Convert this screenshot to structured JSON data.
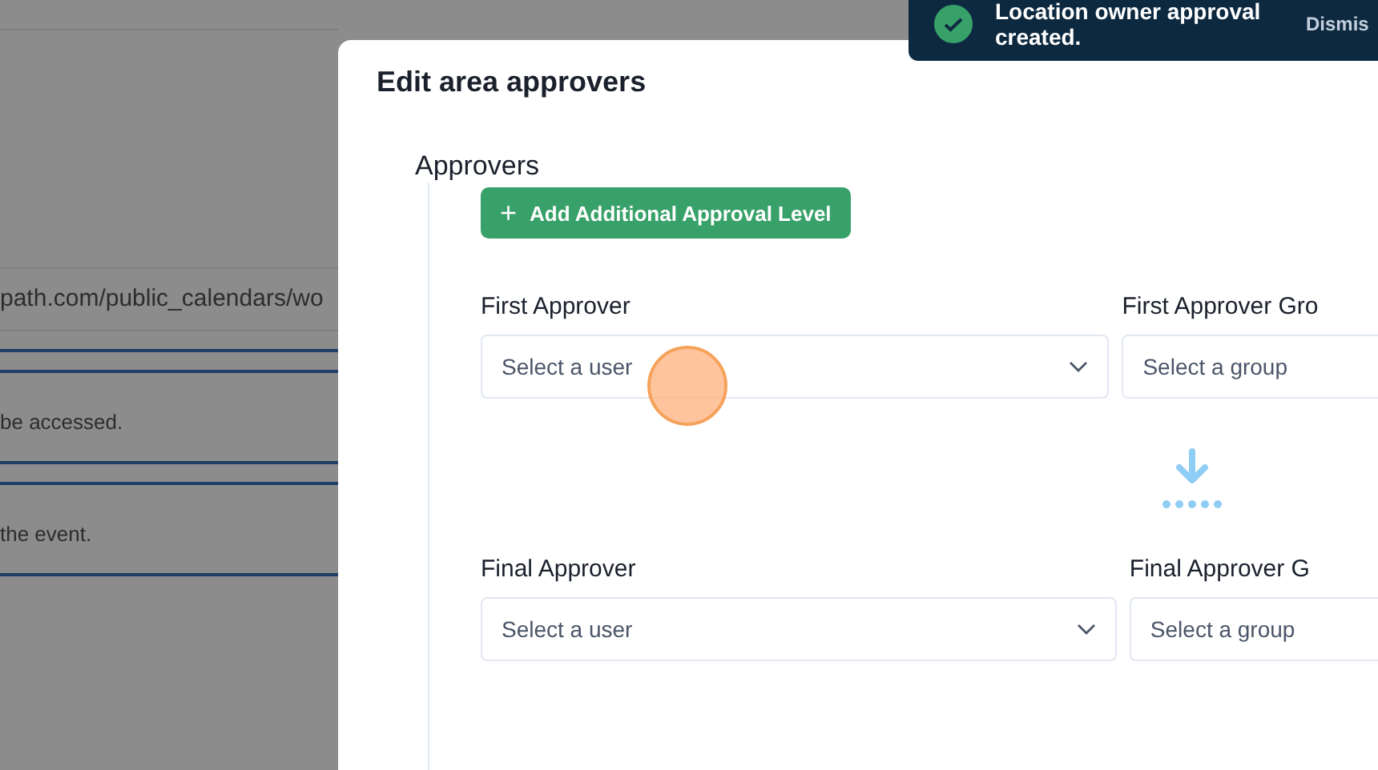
{
  "background_page": {
    "lines": [
      "path.com/public_calendars/wo",
      "be accessed.",
      "the event."
    ]
  },
  "toast": {
    "message": "Location owner approval created.",
    "action": "Dismis"
  },
  "modal": {
    "title": "Edit area approvers",
    "section": "Approvers",
    "add_button": {
      "icon": "+",
      "label": "Add Additional Approval Level"
    },
    "levels": [
      {
        "label": "First Approver",
        "user_placeholder": "Select a user",
        "group_label": "First Approver Gro",
        "group_placeholder": "Select a group"
      },
      {
        "label": "Final Approver",
        "user_placeholder": "Select a user",
        "group_label": "Final Approver G",
        "group_placeholder": "Select a group"
      }
    ]
  }
}
